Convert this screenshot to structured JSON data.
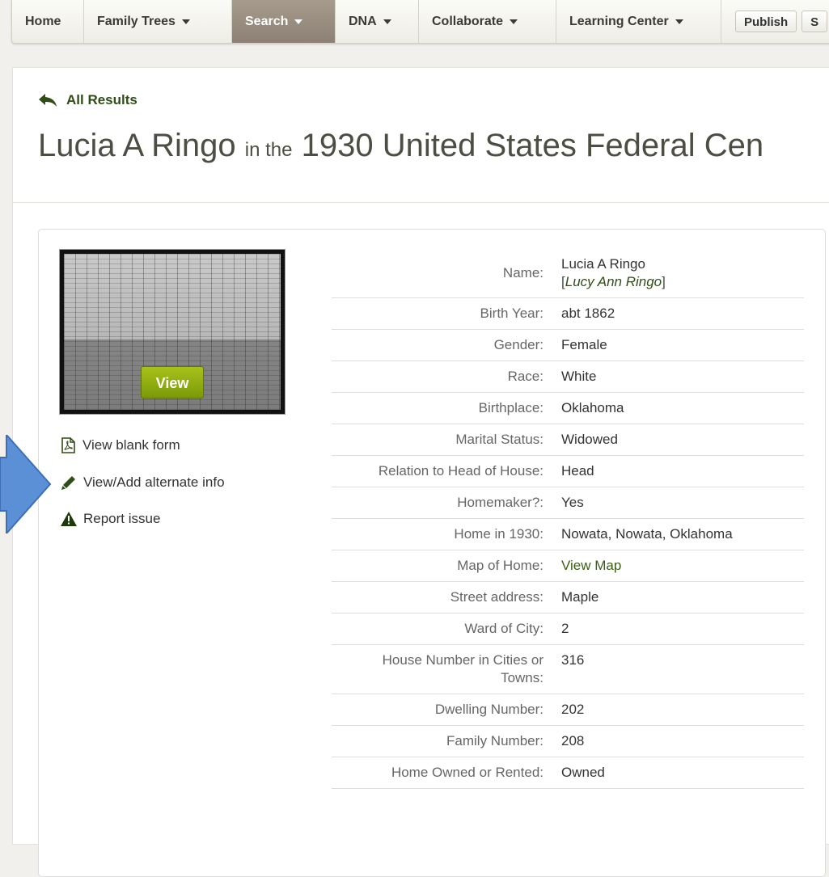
{
  "nav": {
    "items": [
      {
        "label": "Home",
        "caret": false,
        "active": false
      },
      {
        "label": "Family Trees",
        "caret": true,
        "active": false
      },
      {
        "label": "Search",
        "caret": true,
        "active": true
      },
      {
        "label": "DNA",
        "caret": true,
        "active": false
      },
      {
        "label": "Collaborate",
        "caret": true,
        "active": false
      },
      {
        "label": "Learning Center",
        "caret": true,
        "active": false
      }
    ],
    "publish_label": "Publish",
    "second_button_label": "S"
  },
  "back_link": "All Results",
  "title": {
    "name": "Lucia A Ringo",
    "connector": "in the",
    "collection": "1930 United States Federal Cen"
  },
  "thumbnail": {
    "view_label": "View"
  },
  "side_links": {
    "blank_form": "View blank form",
    "alternate_info": "View/Add alternate info",
    "report_issue": "Report issue"
  },
  "details": [
    {
      "key": "Name:",
      "value": "Lucia A Ringo",
      "alt": "Lucy Ann Ringo"
    },
    {
      "key": "Birth Year:",
      "value": "abt 1862"
    },
    {
      "key": "Gender:",
      "value": "Female"
    },
    {
      "key": "Race:",
      "value": "White"
    },
    {
      "key": "Birthplace:",
      "value": "Oklahoma"
    },
    {
      "key": "Marital Status:",
      "value": "Widowed"
    },
    {
      "key": "Relation to Head of House:",
      "value": "Head"
    },
    {
      "key": "Homemaker?:",
      "value": "Yes"
    },
    {
      "key": "Home in 1930:",
      "value": "Nowata, Nowata, Oklahoma"
    },
    {
      "key": "Map of Home:",
      "value": "View Map",
      "link": true
    },
    {
      "key": "Street address:",
      "value": "Maple"
    },
    {
      "key": "Ward of City:",
      "value": "2"
    },
    {
      "key": "House Number in Cities or Towns:",
      "value": "316"
    },
    {
      "key": "Dwelling Number:",
      "value": "202"
    },
    {
      "key": "Family Number:",
      "value": "208"
    },
    {
      "key": "Home Owned or Rented:",
      "value": "Owned"
    }
  ],
  "colors": {
    "accent_green": "#7b9a07",
    "link_green": "#3b5d14",
    "active_tab": "#8c8174",
    "callout_arrow": "#5b8fd6"
  },
  "icons": {
    "back": "arrow-back-icon",
    "blank_form": "pdf-icon",
    "alternate_info": "pencil-icon",
    "report_issue": "warning-icon"
  }
}
